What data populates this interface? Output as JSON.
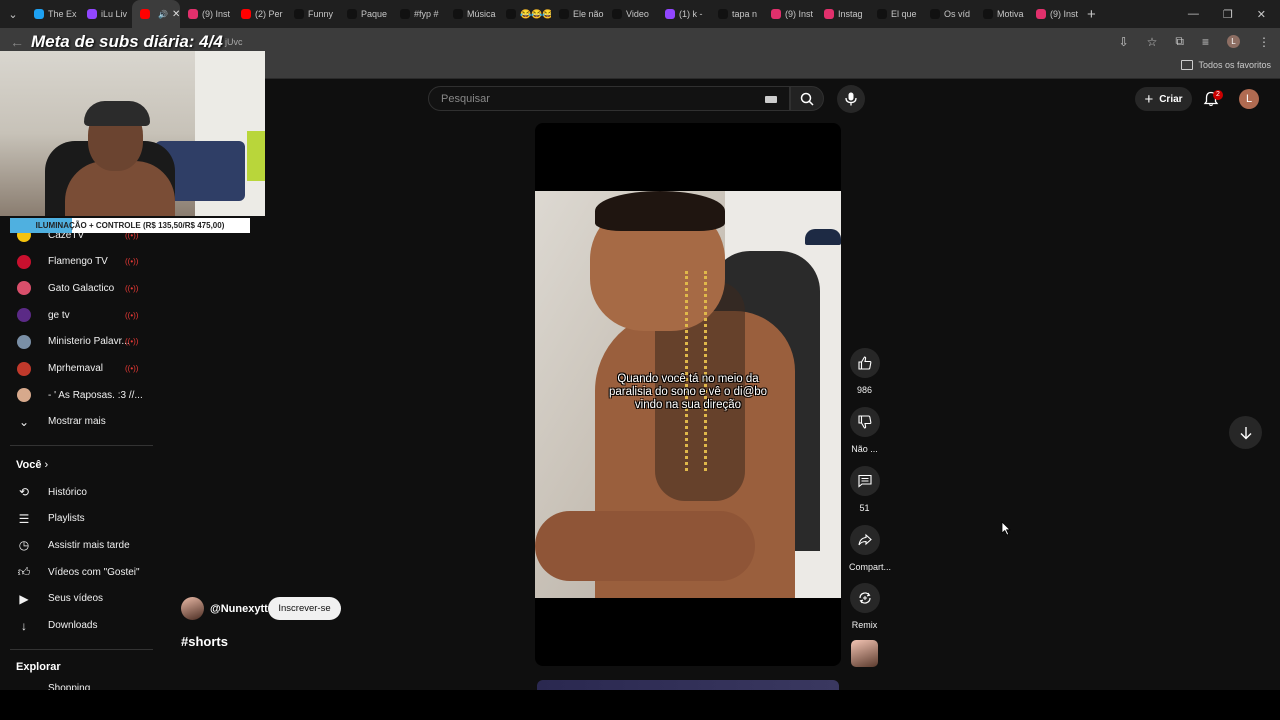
{
  "browser": {
    "tabs": [
      {
        "label": "The Ex",
        "color": "#1da1f2"
      },
      {
        "label": "iLu Liv",
        "color": "#9146ff"
      },
      {
        "label": "",
        "color": "#ff0000",
        "active": true
      },
      {
        "label": "(9) Inst",
        "color": "#e1306c"
      },
      {
        "label": "(2) Per",
        "color": "#ff0000"
      },
      {
        "label": "Funny",
        "color": "#111111"
      },
      {
        "label": "Paque",
        "color": "#111111"
      },
      {
        "label": "#fyp #",
        "color": "#111111"
      },
      {
        "label": "Música",
        "color": "#111111"
      },
      {
        "label": "😂😂😂",
        "color": "#111111"
      },
      {
        "label": "Ele não",
        "color": "#111111"
      },
      {
        "label": "Video",
        "color": "#111111"
      },
      {
        "label": "(1) k -",
        "color": "#9146ff"
      },
      {
        "label": "tapa n",
        "color": "#111111"
      },
      {
        "label": "(9) Inst",
        "color": "#e1306c"
      },
      {
        "label": "Instag",
        "color": "#e1306c"
      },
      {
        "label": "El que",
        "color": "#111111"
      },
      {
        "label": "Os víd",
        "color": "#111111"
      },
      {
        "label": "Motiva",
        "color": "#111111"
      },
      {
        "label": "(9) Inst",
        "color": "#e1306c"
      }
    ],
    "url_fragment": "jUvc",
    "bookmarks_all": "Todos os favoritos",
    "profile_initial": "L"
  },
  "stream_overlay": {
    "title": "Meta de subs diária: 4/4",
    "banner": "ILUMINAÇÃO + CONTROLE (R$ 135,50/R$ 475,00)"
  },
  "sidebar": {
    "subscriptions": [
      {
        "label": "CazéTV",
        "avatar_color": "#f4c20d"
      },
      {
        "label": "Flamengo TV",
        "avatar_color": "#c8102e"
      },
      {
        "label": "Gato Galactico",
        "avatar_color": "#d94f6b"
      },
      {
        "label": "ge tv",
        "avatar_color": "#5b2a86"
      },
      {
        "label": "Ministerio Palavr...",
        "avatar_color": "#7a8fa6"
      },
      {
        "label": "Mprhemaval",
        "avatar_color": "#c0392b"
      },
      {
        "label": "- ' As Raposas. :3 //...",
        "avatar_color": "#d7a98c"
      }
    ],
    "show_more": "Mostrar mais",
    "you_header": "Você",
    "you_items": [
      {
        "label": "Histórico",
        "icon": "history-icon"
      },
      {
        "label": "Playlists",
        "icon": "playlist-icon"
      },
      {
        "label": "Assistir mais tarde",
        "icon": "clock-icon"
      },
      {
        "label": "Vídeos com \"Gostei\"",
        "icon": "like-icon"
      },
      {
        "label": "Seus vídeos",
        "icon": "video-icon"
      },
      {
        "label": "Downloads",
        "icon": "download-icon"
      }
    ],
    "explore_header": "Explorar",
    "explore_partial": "Shopping"
  },
  "masthead": {
    "search_placeholder": "Pesquisar",
    "create_label": "Criar",
    "notification_count": "2",
    "avatar_initial": "L"
  },
  "short": {
    "caption_lines": [
      "Quando você tá no meio da",
      "paralisia do sono e vê o di@bo",
      "vindo na sua direção"
    ],
    "channel": "@Nunexytt",
    "subscribe_label": "Inscrever-se",
    "hashtag": "#shorts",
    "actions": {
      "like_count": "986",
      "dislike_label": "Não ...",
      "comment_count": "51",
      "share_label": "Compart...",
      "remix_label": "Remix"
    }
  }
}
